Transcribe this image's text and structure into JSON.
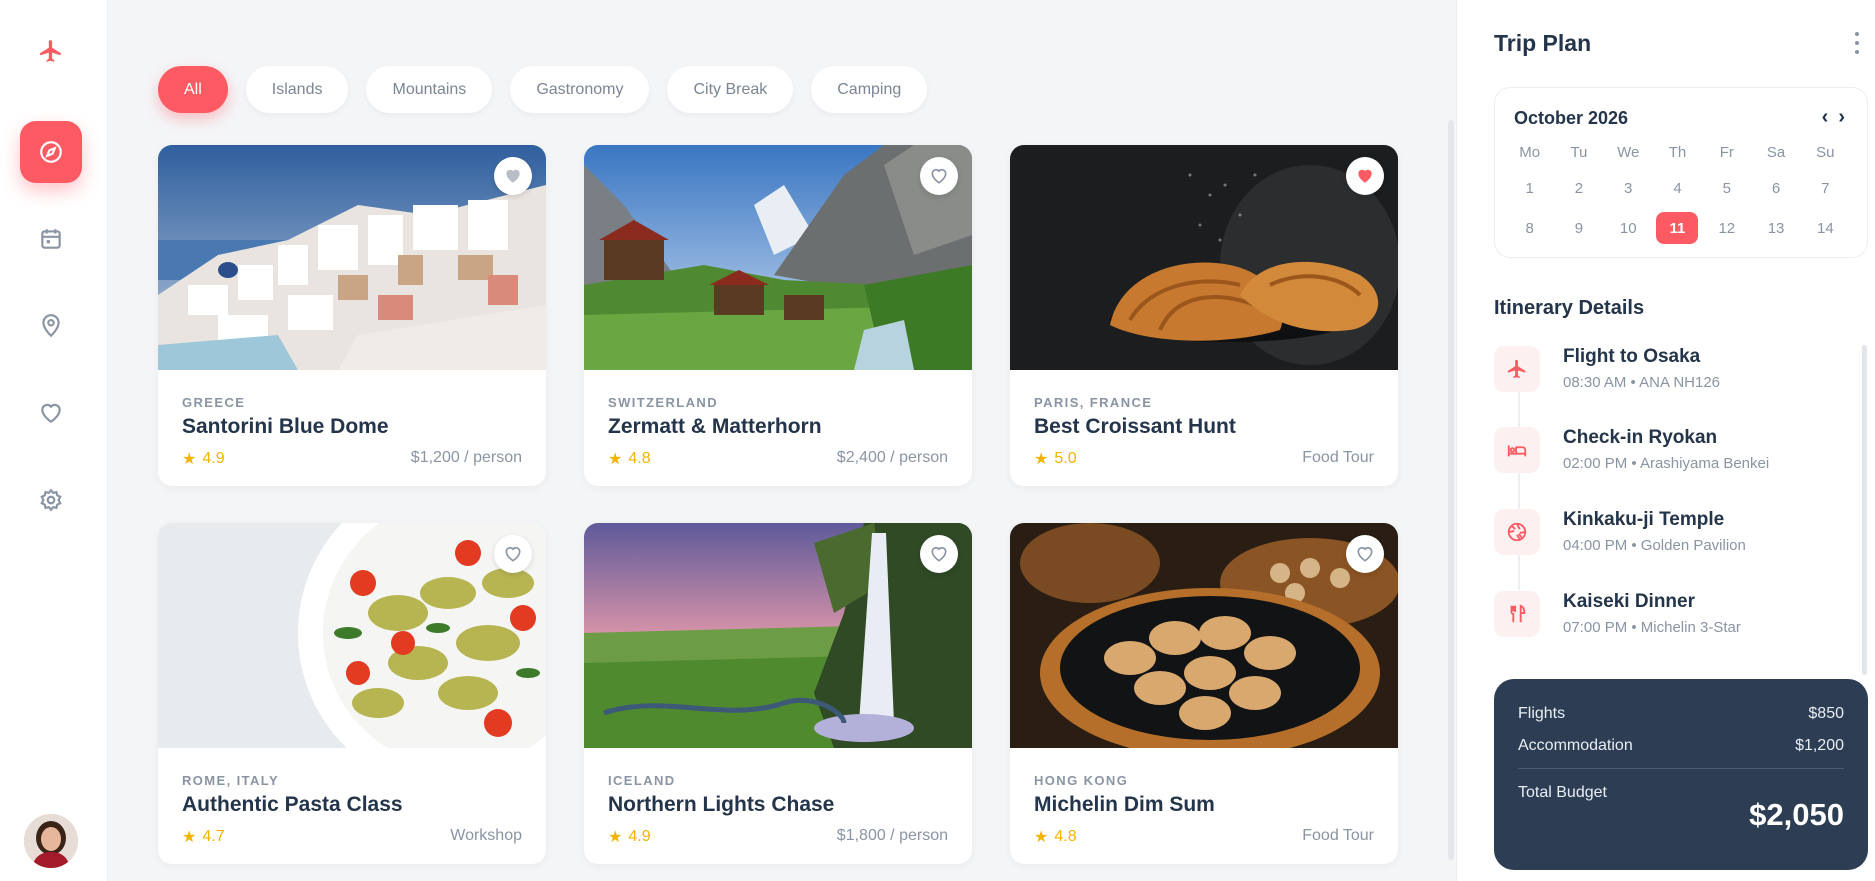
{
  "filters": [
    {
      "label": "All",
      "active": true
    },
    {
      "label": "Islands"
    },
    {
      "label": "Mountains"
    },
    {
      "label": "Gastronomy"
    },
    {
      "label": "City Break"
    },
    {
      "label": "Camping"
    }
  ],
  "cards": [
    {
      "location": "GREECE",
      "title": "Santorini Blue Dome",
      "rating": "4.9",
      "price": "$1,200 / person",
      "favorited": false
    },
    {
      "location": "SWITZERLAND",
      "title": "Zermatt & Matterhorn",
      "rating": "4.8",
      "price": "$2,400 / person",
      "favorited": false
    },
    {
      "location": "PARIS, FRANCE",
      "title": "Best Croissant Hunt",
      "rating": "5.0",
      "price": "Food Tour",
      "favorited": true
    },
    {
      "location": "ROME, ITALY",
      "title": "Authentic Pasta Class",
      "rating": "4.7",
      "price": "Workshop",
      "favorited": false
    },
    {
      "location": "ICELAND",
      "title": "Northern Lights Chase",
      "rating": "4.9",
      "price": "$1,800 / person",
      "favorited": false
    },
    {
      "location": "HONG KONG",
      "title": "Michelin Dim Sum",
      "rating": "4.8",
      "price": "Food Tour",
      "favorited": false
    }
  ],
  "trip_plan": {
    "title": "Trip Plan",
    "calendar": {
      "month": "October 2026",
      "weekdays": [
        "Mo",
        "Tu",
        "We",
        "Th",
        "Fr",
        "Sa",
        "Su"
      ],
      "days": [
        "1",
        "2",
        "3",
        "4",
        "5",
        "6",
        "7",
        "8",
        "9",
        "10",
        "11",
        "12",
        "13",
        "14"
      ],
      "selected": "11"
    },
    "itinerary_title": "Itinerary Details",
    "itinerary": [
      {
        "name": "Flight to Osaka",
        "detail": "08:30 AM • ANA NH126",
        "icon": "plane-icon"
      },
      {
        "name": "Check-in Ryokan",
        "detail": "02:00 PM • Arashiyama Benkei",
        "icon": "bed-icon"
      },
      {
        "name": "Kinkaku-ji Temple",
        "detail": "04:00 PM • Golden Pavilion",
        "icon": "camera-aperture-icon"
      },
      {
        "name": "Kaiseki Dinner",
        "detail": "07:00 PM • Michelin 3-Star",
        "icon": "utensils-icon"
      }
    ],
    "budget": {
      "flights_label": "Flights",
      "flights_value": "$850",
      "accommodation_label": "Accommodation",
      "accommodation_value": "$1,200",
      "total_label": "Total Budget",
      "total_value": "$2,050"
    }
  },
  "colors": {
    "accent": "#fe5a63",
    "dark": "#2d3e54",
    "star": "#f2b400"
  }
}
